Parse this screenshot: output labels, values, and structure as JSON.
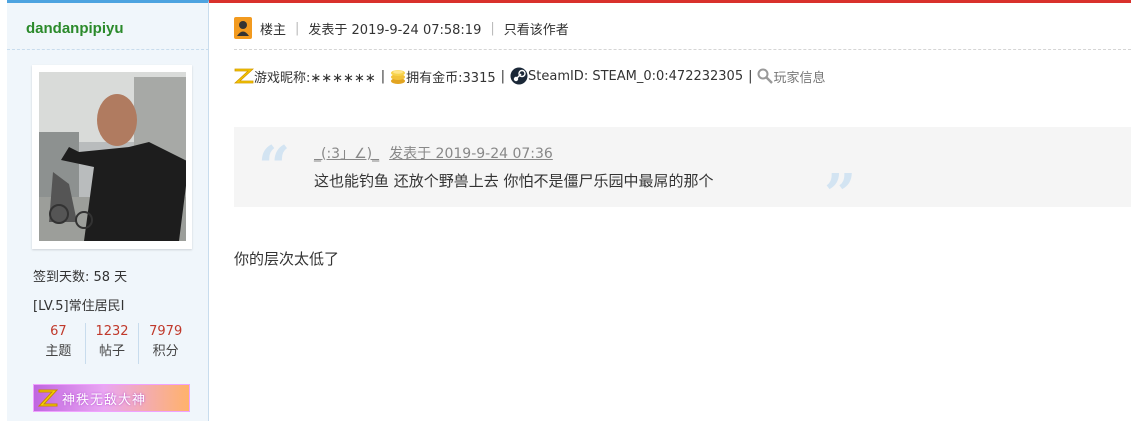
{
  "user": {
    "username": "dandanpipiyu",
    "sign_days": "签到天数: 58 天",
    "level": "[LV.5]常住居民I",
    "stats": [
      {
        "value": "67",
        "label": "主题"
      },
      {
        "value": "1232",
        "label": "帖子"
      },
      {
        "value": "7979",
        "label": "积分"
      }
    ],
    "medal": "神秩无敌大神"
  },
  "post": {
    "role": "楼主",
    "posted": "发表于 2019-9-24 07:58:19",
    "only_author": "只看该作者",
    "game_nick": "游戏昵称:∗∗∗∗∗∗",
    "coins": "拥有金币:3315",
    "steam": "SteamID: STEAM_0:0:472232305",
    "player_info": "玩家信息",
    "quote": {
      "author": "_(:3」∠)_",
      "time": "发表于 2019-9-24 07:36",
      "text": "这也能钓鱼 还放个野兽上去 你怕不是僵尸乐园中最屌的那个"
    },
    "content": "你的层次太低了"
  },
  "colors": {
    "accent_red": "#d9312c",
    "accent_blue": "#4da3e0",
    "username_green": "#2b8a2b",
    "stat_red": "#c0392b"
  }
}
